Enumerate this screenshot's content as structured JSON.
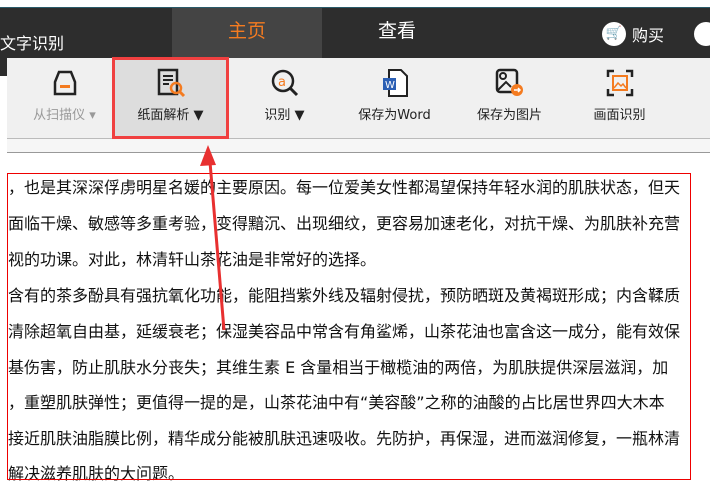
{
  "app_title": "文字识别",
  "tabs": [
    {
      "label": "主页",
      "active": true
    },
    {
      "label": "查看",
      "active": false
    }
  ],
  "buy_label": "购买",
  "toolbar": [
    {
      "label": "从扫描仪 ▾",
      "icon": "scanner-icon",
      "disabled": true
    },
    {
      "label": "纸面解析 ▼",
      "icon": "document-search-icon",
      "selected": true
    },
    {
      "label": "识别 ▼",
      "icon": "ocr-magnifier-icon"
    },
    {
      "label": "保存为Word",
      "icon": "word-icon"
    },
    {
      "label": "保存为图片",
      "icon": "save-image-icon"
    },
    {
      "label": "画面识别",
      "icon": "screen-capture-icon"
    }
  ],
  "document_lines": [
    "，也是其深深俘虏明星名媛的主要原因。每一位爱美女性都渴望保持年轻水润的肌肤状态，但天",
    "面临干燥、敏感等多重考验，变得黯沉、出现细纹，更容易加速老化，对抗干燥、为肌肤补充营",
    "视的功课。对此，林清轩山茶花油是非常好的选择。",
    "含有的茶多酚具有强抗氧化功能，能阻挡紫外线及辐射侵扰，预防晒斑及黄褐斑形成；内含鞣质",
    "清除超氧自由基，延缓衰老；保湿美容品中常含有角鲨烯，山茶花油也富含这一成分，能有效保",
    "基伤害，防止肌肤水分丧失；其维生素 E 含量相当于橄榄油的两倍，为肌肤提供深层滋润，加",
    "，重塑肌肤弹性；更值得一提的是，山茶花油中有“美容酸”之称的油酸的占比居世界四大木本",
    "接近肌肤油脂膜比例，精华成分能被肌肤迅速吸收。先防护，再保湿，进而滋润修复，一瓶林清",
    "解决滋养肌肤的大问题。"
  ],
  "colors": {
    "accent": "#f47b20",
    "highlight": "#f04040",
    "titlebar": "#2d2d2d"
  }
}
